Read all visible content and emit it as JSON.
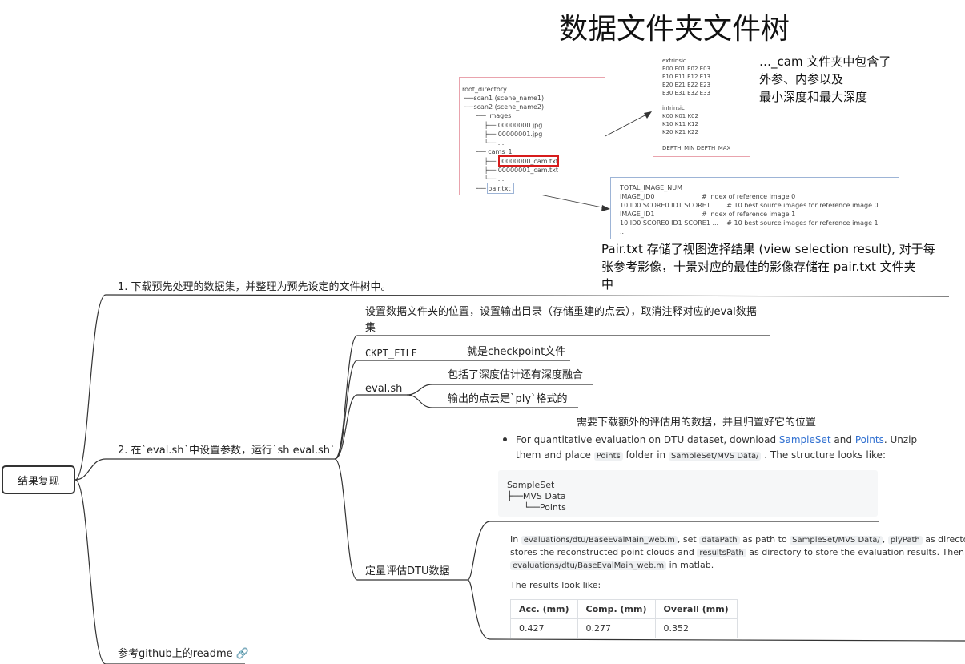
{
  "title": "数据文件夹文件树",
  "root": {
    "label": "结果复现"
  },
  "branches": {
    "b1": "1. 下载预先处理的数据集，并整理为预先设定的文件树中。",
    "b2": "2. 在`eval.sh`中设置参数，运行`sh eval.sh`",
    "b3": "参考github上的readme"
  },
  "sub": {
    "s1_line1": "设置数据文件夹的位置，设置输出目录（存储重建的点云），取消注释对应的eval数据",
    "s1_line2": "集",
    "ckpt": "CKPT_FILE",
    "ckpt_note": "就是checkpoint文件",
    "evalsh": "eval.sh",
    "evalsh_a": "包括了深度估计还有深度融合",
    "evalsh_b": "输出的点云是`ply`格式的",
    "dtu": "定量评估DTU数据",
    "dtu_note": "需要下载额外的评估用的数据，并且归置好它的位置"
  },
  "tree": {
    "lines": [
      "root_directory",
      "├──scan1 (scene_name1)",
      "├──scan2 (scene_name2)",
      "      ├── images",
      "      │   ├── 00000000.jpg",
      "      │   ├── 00000001.jpg",
      "      │   └── ...",
      "      ├── cams_1",
      "      │   ├── 00000000_cam.txt",
      "      │   ├── 00000001_cam.txt",
      "      │   └── ...",
      "      └── pair.txt"
    ]
  },
  "cam_file": {
    "lines": [
      "extrinsic",
      "E00 E01 E02 E03",
      "E10 E11 E12 E13",
      "E20 E21 E22 E23",
      "E30 E31 E32 E33",
      "",
      "intrinsic",
      "K00 K01 K02",
      "K10 K11 K12",
      "K20 K21 K22",
      "",
      "DEPTH_MIN DEPTH_MAX"
    ],
    "note1": "…_cam 文件夹中包含了",
    "note2": "外参、内参以及",
    "note3": "最小深度和最大深度"
  },
  "pair_file": {
    "lines": [
      "TOTAL_IMAGE_NUM",
      "IMAGE_ID0                       # index of reference image 0",
      "10 ID0 SCORE0 ID1 SCORE1 ...    # 10 best source images for reference image 0",
      "IMAGE_ID1                       # index of reference image 1",
      "10 ID0 SCORE0 ID1 SCORE1 ...    # 10 best source images for reference image 1",
      "..."
    ],
    "note1": "Pair.txt 存储了视图选择结果 (view selection result), 对于每",
    "note2": "张参考影像，十景对应的最佳的影像存储在 pair.txt 文件夹",
    "note3": "中"
  },
  "dtu_doc": {
    "p1_a": "For quantitative evaluation on DTU dataset, download ",
    "link1": "SampleSet",
    "and": " and ",
    "link2": "Points",
    "p1_b": ". Unzip",
    "p1_c": "them and place ",
    "code_points": "Points",
    "p1_d": " folder in ",
    "code_mvs": "SampleSet/MVS Data/",
    "p1_e": " . The structure looks like:",
    "struct": [
      "SampleSet",
      "├──MVS Data",
      "      └──Points"
    ],
    "p2_a": "In ",
    "code_m1": "evaluations/dtu/BaseEvalMain_web.m",
    "p2_b": ", set ",
    "code_dp": "dataPath",
    "p2_c": " as path to ",
    "code_mvs2": "SampleSet/MVS Data/",
    "p2_d": ", ",
    "code_ply": "plyPath",
    "p2_e": " as directory that",
    "p2_f": "stores the reconstructed point clouds and ",
    "code_res": "resultsPath",
    "p2_g": " as directory to store the evaluation results. Then run",
    "code_m2": "evaluations/dtu/BaseEvalMain_web.m",
    "p2_h": " in matlab.",
    "p3": "The results look like:",
    "table": {
      "headers": [
        "Acc. (mm)",
        "Comp. (mm)",
        "Overall (mm)"
      ],
      "row": [
        "0.427",
        "0.277",
        "0.352"
      ]
    }
  },
  "colors": {
    "pink_border": "#e9a3ad",
    "blue_border": "#9db4d6",
    "red_highlight": "#d71c1c",
    "link": "#2f6fd0"
  },
  "icons": {
    "link": "link-icon"
  }
}
